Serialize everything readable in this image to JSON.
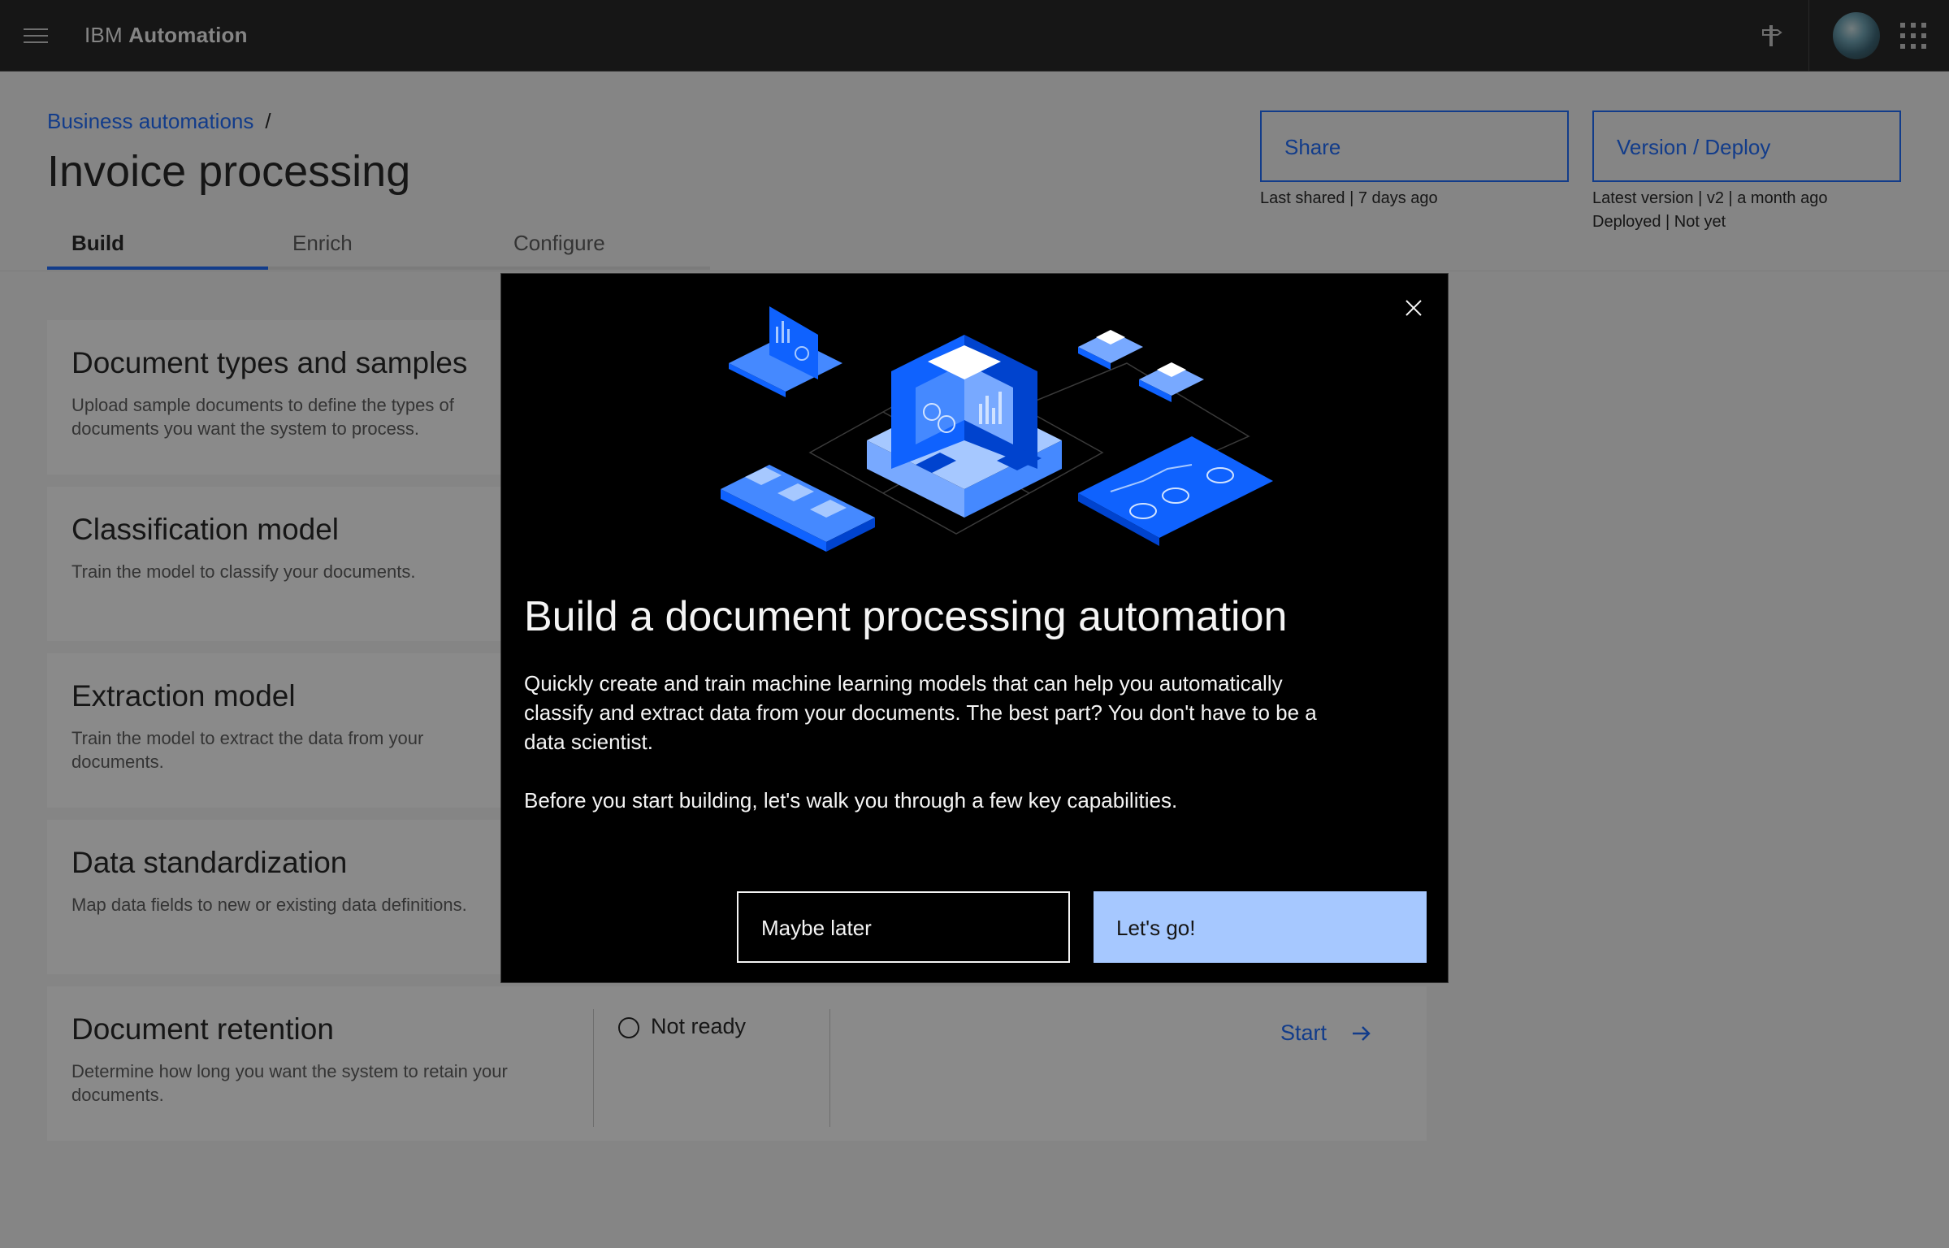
{
  "header": {
    "brand_prefix": "IBM",
    "brand_name": "Automation"
  },
  "breadcrumb": {
    "parent": "Business automations",
    "separator": "/"
  },
  "page": {
    "title": "Invoice processing"
  },
  "tabs": [
    {
      "label": "Build",
      "active": true
    },
    {
      "label": "Enrich",
      "active": false
    },
    {
      "label": "Configure",
      "active": false
    }
  ],
  "actions": {
    "share_label": "Share",
    "share_meta": "Last shared | 7 days ago",
    "version_label": "Version / Deploy",
    "version_meta": "Latest version | v2 | a month ago",
    "deploy_meta": "Deployed | Not yet"
  },
  "cards": [
    {
      "title": "Document types and samples",
      "desc": "Upload sample documents to define the types of documents you want the system to process."
    },
    {
      "title": "Classification model",
      "desc": "Train the model to classify your documents."
    },
    {
      "title": "Extraction model",
      "desc": "Train the model to extract the data from your documents."
    },
    {
      "title": "Data standardization",
      "desc": "Map data fields to new or existing data definitions."
    },
    {
      "title": "Document retention",
      "desc": "Determine how long you want the system to retain your documents.",
      "status": "Not ready",
      "action": "Start"
    }
  ],
  "modal": {
    "title": "Build a document processing automation",
    "body1": "Quickly create and train machine learning models that can help you automatically classify and extract data from your documents. The best part? You don't have to be a data scientist.",
    "body2": "Before you start building, let's walk you through a few key capabilities.",
    "secondary_label": "Maybe later",
    "primary_label": "Let's go!"
  },
  "colors": {
    "accent": "#0f62fe",
    "header_bg": "#161616",
    "primary_button": "#a6c8ff"
  },
  "icons": [
    "menu-icon",
    "signpost-icon",
    "avatar",
    "app-switcher-icon",
    "close-icon",
    "arrow-right-icon",
    "circle-status-icon"
  ]
}
